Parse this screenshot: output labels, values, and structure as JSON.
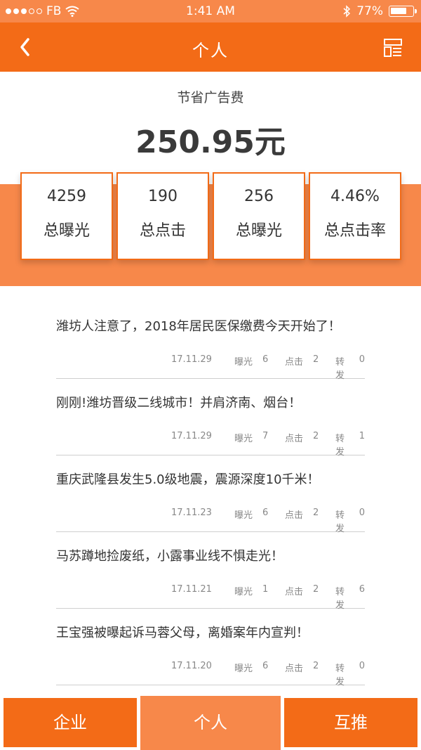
{
  "status_bar": {
    "carrier": "FB",
    "time": "1:41 AM",
    "battery_percent": "77%",
    "battery_level": 0.77,
    "icons": [
      "signal-dots-icon",
      "wifi-icon",
      "bluetooth-icon",
      "battery-icon"
    ]
  },
  "nav": {
    "title": "个人",
    "back_icon": "chevron-left-icon",
    "menu_icon": "layout-menu-icon"
  },
  "savings": {
    "label": "节省广告费",
    "amount": "250.95元"
  },
  "stats": [
    {
      "value": "4259",
      "label": "总曝光"
    },
    {
      "value": "190",
      "label": "总点击"
    },
    {
      "value": "256",
      "label": "总曝光"
    },
    {
      "value": "4.46%",
      "label": "总点击率"
    }
  ],
  "feed": {
    "meta_labels": {
      "exposure": "曝光",
      "clicks": "点击",
      "shares": "转发"
    },
    "items": [
      {
        "title": "潍坊人注意了，2018年居民医保缴费今天开始了！",
        "date": "17.11.29",
        "exposure": "6",
        "clicks": "2",
        "shares": "0"
      },
      {
        "title": "刚刚!潍坊晋级二线城市！并肩济南、烟台！",
        "date": "17.11.29",
        "exposure": "7",
        "clicks": "2",
        "shares": "1"
      },
      {
        "title": "重庆武隆县发生5.0级地震，震源深度10千米！",
        "date": "17.11.23",
        "exposure": "6",
        "clicks": "2",
        "shares": "0"
      },
      {
        "title": "马苏蹲地捡废纸，小露事业线不惧走光！",
        "date": "17.11.21",
        "exposure": "1",
        "clicks": "2",
        "shares": "6"
      },
      {
        "title": "王宝强被曝起诉马蓉父母，离婚案年内宣判！",
        "date": "17.11.20",
        "exposure": "6",
        "clicks": "2",
        "shares": "0"
      }
    ]
  },
  "tabs": [
    {
      "label": "企业",
      "active": false
    },
    {
      "label": "个人",
      "active": true
    },
    {
      "label": "互推",
      "active": false
    }
  ],
  "colors": {
    "primary": "#f36b17",
    "light": "#f7884a"
  }
}
